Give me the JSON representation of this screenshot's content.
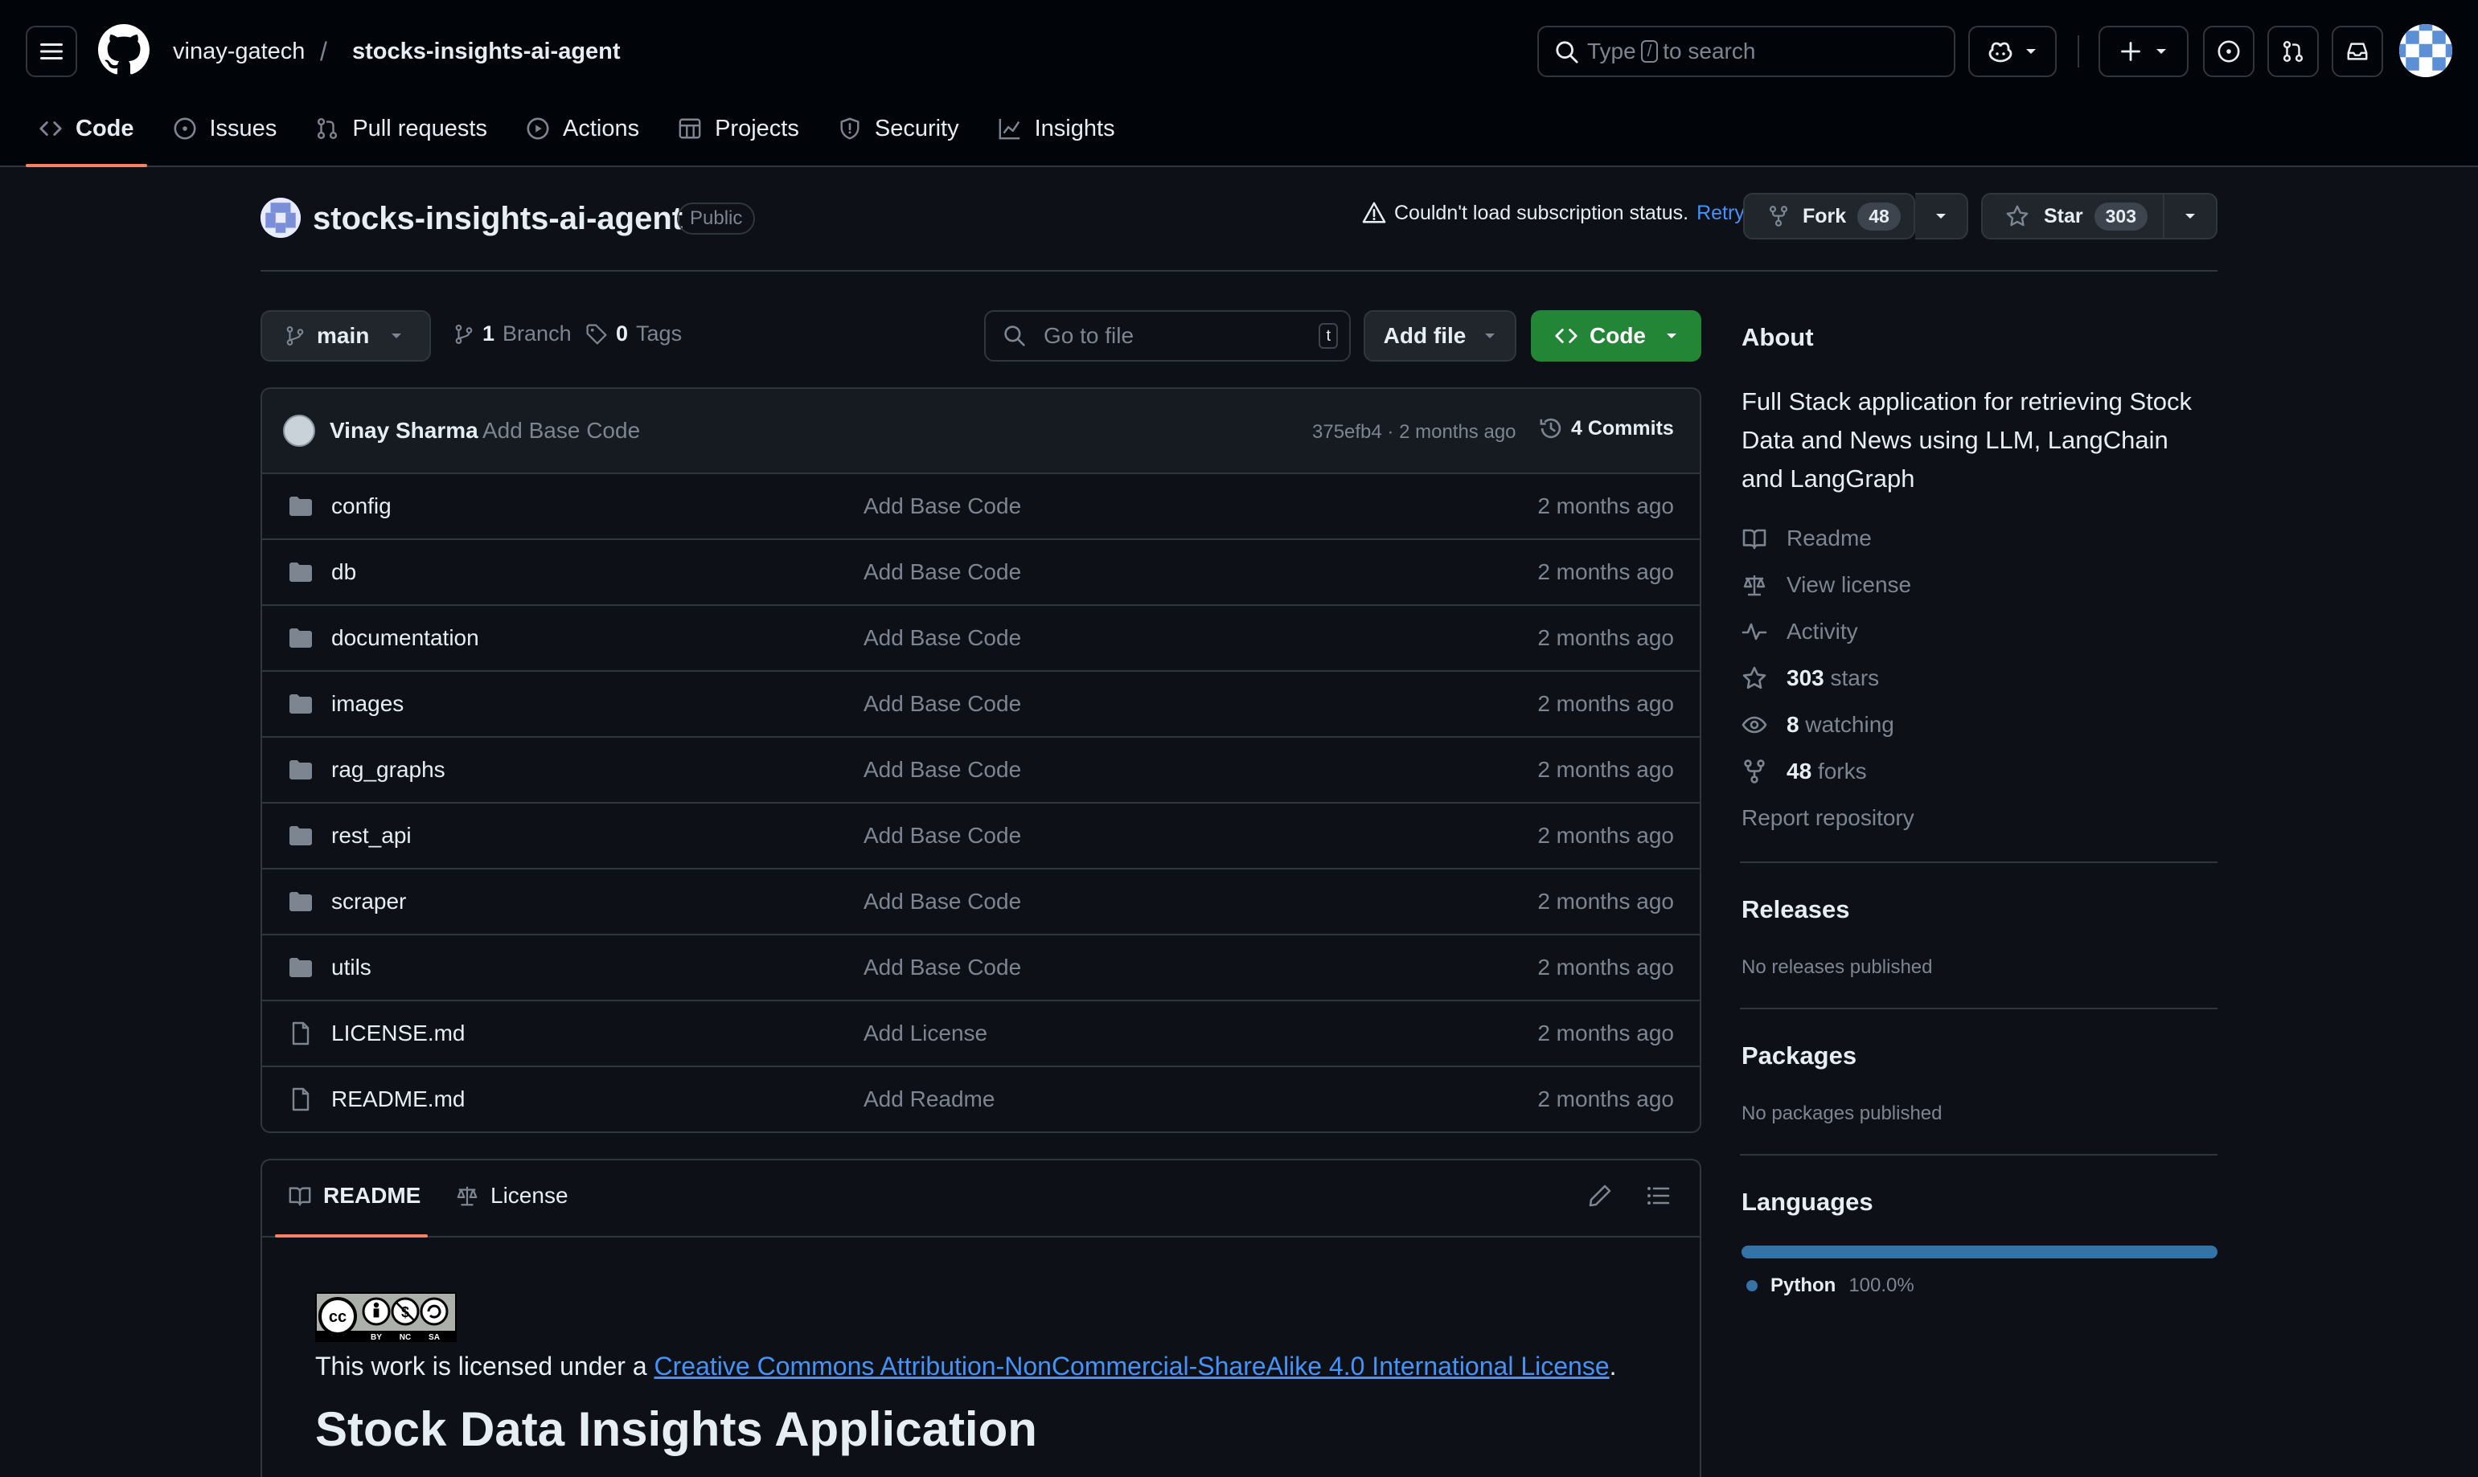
{
  "header": {
    "owner": "vinay-gatech",
    "separator": "/",
    "repo": "stocks-insights-ai-agent",
    "search_prefix": "Type",
    "search_key": "/",
    "search_suffix": "to search"
  },
  "nav_tabs": [
    {
      "label": "Code",
      "icon": "code-icon"
    },
    {
      "label": "Issues",
      "icon": "issue-icon"
    },
    {
      "label": "Pull requests",
      "icon": "pull-request-icon"
    },
    {
      "label": "Actions",
      "icon": "play-icon"
    },
    {
      "label": "Projects",
      "icon": "table-icon"
    },
    {
      "label": "Security",
      "icon": "shield-icon"
    },
    {
      "label": "Insights",
      "icon": "graph-icon"
    }
  ],
  "repo": {
    "name": "stocks-insights-ai-agent",
    "visibility": "Public",
    "subscription_warning": "Couldn't load subscription status.",
    "retry": "Retry",
    "fork_label": "Fork",
    "fork_count": "48",
    "star_label": "Star",
    "star_count": "303"
  },
  "toolbar": {
    "branch": "main",
    "branch_count": "1",
    "branch_label": "Branch",
    "tag_count": "0",
    "tag_label": "Tags",
    "goto_placeholder": "Go to file",
    "goto_key": "t",
    "add_file": "Add file",
    "code": "Code"
  },
  "commit": {
    "author": "Vinay Sharma",
    "message": "Add Base Code",
    "hash_time": "375efb4 · 2 months ago",
    "count": "4 Commits"
  },
  "files": [
    {
      "name": "config",
      "type": "folder",
      "message": "Add Base Code",
      "time": "2 months ago"
    },
    {
      "name": "db",
      "type": "folder",
      "message": "Add Base Code",
      "time": "2 months ago"
    },
    {
      "name": "documentation",
      "type": "folder",
      "message": "Add Base Code",
      "time": "2 months ago"
    },
    {
      "name": "images",
      "type": "folder",
      "message": "Add Base Code",
      "time": "2 months ago"
    },
    {
      "name": "rag_graphs",
      "type": "folder",
      "message": "Add Base Code",
      "time": "2 months ago"
    },
    {
      "name": "rest_api",
      "type": "folder",
      "message": "Add Base Code",
      "time": "2 months ago"
    },
    {
      "name": "scraper",
      "type": "folder",
      "message": "Add Base Code",
      "time": "2 months ago"
    },
    {
      "name": "utils",
      "type": "folder",
      "message": "Add Base Code",
      "time": "2 months ago"
    },
    {
      "name": "LICENSE.md",
      "type": "file",
      "message": "Add License",
      "time": "2 months ago"
    },
    {
      "name": "README.md",
      "type": "file",
      "message": "Add Readme",
      "time": "2 months ago"
    }
  ],
  "readme": {
    "tab_readme": "README",
    "tab_license": "License",
    "cc_badge_text": "BY NC SA",
    "license_prefix": "This work is licensed under a ",
    "license_link": "Creative Commons Attribution-NonCommercial-ShareAlike 4.0 International License",
    "license_suffix": ".",
    "heading": "Stock Data Insights Application"
  },
  "about": {
    "title": "About",
    "description": "Full Stack application for retrieving Stock Data and News using LLM, LangChain and LangGraph",
    "readme": "Readme",
    "license": "View license",
    "activity": "Activity",
    "stars_count": "303",
    "stars_label": "stars",
    "watching_count": "8",
    "watching_label": "watching",
    "forks_count": "48",
    "forks_label": "forks",
    "report": "Report repository"
  },
  "releases": {
    "title": "Releases",
    "note": "No releases published"
  },
  "packages": {
    "title": "Packages",
    "note": "No packages published"
  },
  "languages": {
    "title": "Languages",
    "items": [
      {
        "name": "Python",
        "percent": "100.0%",
        "fraction": 1.0,
        "color": "#3572a5"
      }
    ]
  },
  "colors": {
    "background": "#0d1117",
    "header": "#010409",
    "border": "#30363d",
    "accent_tab": "#f78166",
    "link": "#4493f8",
    "code_button": "#238636"
  }
}
